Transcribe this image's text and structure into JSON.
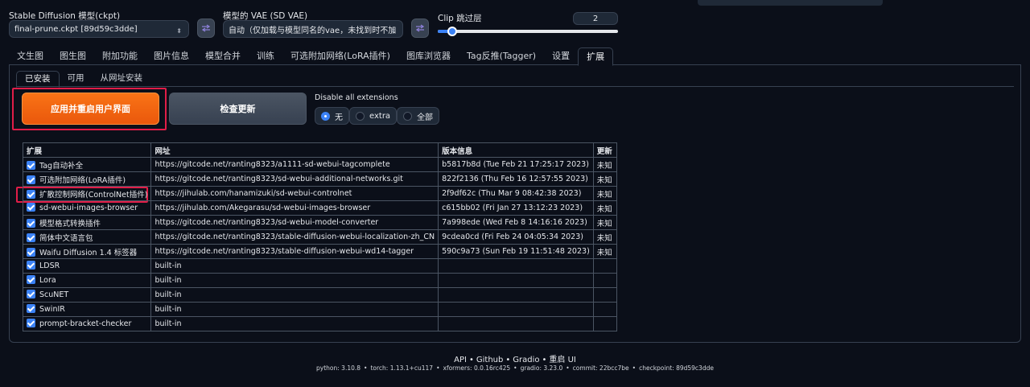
{
  "header": {
    "ckpt_label": "Stable Diffusion 模型(ckpt)",
    "ckpt_value": "final-prune.ckpt [89d59c3dde]",
    "vae_label": "模型的 VAE (SD VAE)",
    "vae_value": "自动（仅加载与模型同名的vae，未找到时不加",
    "clip_label": "Clip 跳过层",
    "clip_value": "2",
    "clip_fraction": 0.08
  },
  "tabs": [
    "文生图",
    "图生图",
    "附加功能",
    "图片信息",
    "模型合并",
    "训练",
    "可选附加网络(LoRA插件)",
    "图库浏览器",
    "Tag反推(Tagger)",
    "设置",
    "扩展"
  ],
  "active_tab": "扩展",
  "subtabs": [
    "已安装",
    "可用",
    "从网址安装"
  ],
  "buttons": {
    "apply_restart": "应用并重启用户界面",
    "check_updates": "检查更新"
  },
  "disable_all": {
    "label": "Disable all extensions",
    "options": [
      "无",
      "extra",
      "全部"
    ],
    "selected": "无"
  },
  "table": {
    "headers": [
      "扩展",
      "网址",
      "版本信息",
      "更新"
    ],
    "rows": [
      {
        "name": "Tag自动补全",
        "url": "https://gitcode.net/ranting8323/a1111-sd-webui-tagcomplete",
        "version": "b5817b8d (Tue Feb 21 17:25:17 2023)",
        "update": "未知"
      },
      {
        "name": "可选附加网络(LoRA插件)",
        "url": "https://gitcode.net/ranting8323/sd-webui-additional-networks.git",
        "version": "822f2136 (Thu Feb 16 12:57:55 2023)",
        "update": "未知"
      },
      {
        "name": "扩散控制网络(ControlNet插件)",
        "url": "https://jihulab.com/hanamizuki/sd-webui-controlnet",
        "version": "2f9df62c (Thu Mar 9 08:42:38 2023)",
        "update": "未知"
      },
      {
        "name": "sd-webui-images-browser",
        "url": "https://jihulab.com/Akegarasu/sd-webui-images-browser",
        "version": "c615bb02 (Fri Jan 27 13:12:23 2023)",
        "update": "未知"
      },
      {
        "name": "模型格式转换插件",
        "url": "https://gitcode.net/ranting8323/sd-webui-model-converter",
        "version": "7a998ede (Wed Feb 8 14:16:16 2023)",
        "update": "未知"
      },
      {
        "name": "简体中文语言包",
        "url": "https://gitcode.net/ranting8323/stable-diffusion-webui-localization-zh_CN",
        "version": "9cdea0cd (Fri Feb 24 04:05:34 2023)",
        "update": "未知"
      },
      {
        "name": "Waifu Diffusion 1.4 标签器",
        "url": "https://gitcode.net/ranting8323/stable-diffusion-webui-wd14-tagger",
        "version": "590c9a73 (Sun Feb 19 11:51:48 2023)",
        "update": "未知"
      },
      {
        "name": "LDSR",
        "url": "built-in",
        "version": "",
        "update": ""
      },
      {
        "name": "Lora",
        "url": "built-in",
        "version": "",
        "update": ""
      },
      {
        "name": "ScuNET",
        "url": "built-in",
        "version": "",
        "update": ""
      },
      {
        "name": "SwinIR",
        "url": "built-in",
        "version": "",
        "update": ""
      },
      {
        "name": "prompt-bracket-checker",
        "url": "built-in",
        "version": "",
        "update": ""
      }
    ]
  },
  "footer": {
    "links": [
      "API",
      "Github",
      "Gradio",
      "重启 UI"
    ],
    "separator": "•",
    "versions": [
      "python: 3.10.8",
      "torch: 1.13.1+cu117",
      "xformers: 0.0.16rc425",
      "gradio: 3.23.0",
      "commit: 22bcc7be",
      "checkpoint: 89d59c3dde"
    ]
  }
}
